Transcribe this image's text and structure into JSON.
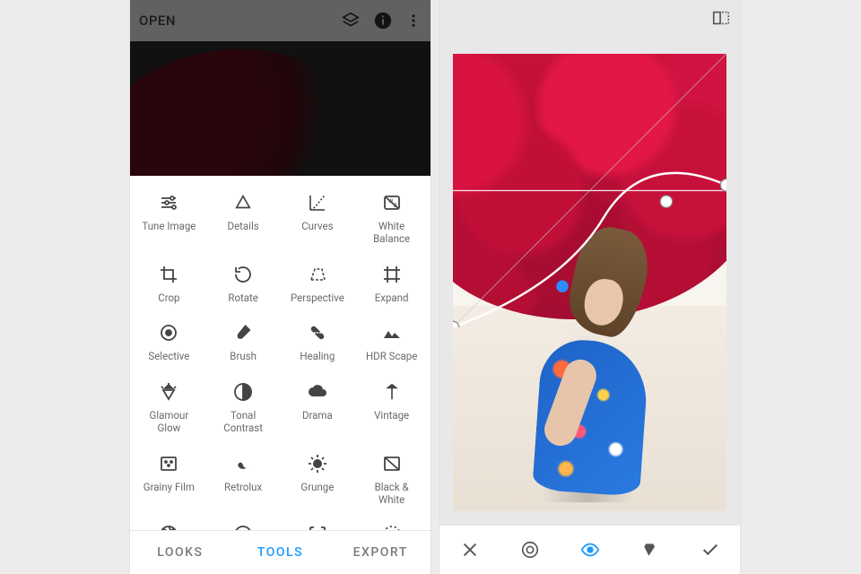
{
  "left": {
    "topbar": {
      "open_label": "OPEN"
    },
    "tools": [
      {
        "id": "tune-image",
        "label": "Tune Image"
      },
      {
        "id": "details",
        "label": "Details"
      },
      {
        "id": "curves",
        "label": "Curves"
      },
      {
        "id": "white-balance",
        "label": "White\nBalance"
      },
      {
        "id": "crop",
        "label": "Crop"
      },
      {
        "id": "rotate",
        "label": "Rotate"
      },
      {
        "id": "perspective",
        "label": "Perspective"
      },
      {
        "id": "expand",
        "label": "Expand"
      },
      {
        "id": "selective",
        "label": "Selective"
      },
      {
        "id": "brush",
        "label": "Brush"
      },
      {
        "id": "healing",
        "label": "Healing"
      },
      {
        "id": "hdr-scape",
        "label": "HDR Scape"
      },
      {
        "id": "glamour-glow",
        "label": "Glamour\nGlow"
      },
      {
        "id": "tonal-contrast",
        "label": "Tonal\nContrast"
      },
      {
        "id": "drama",
        "label": "Drama"
      },
      {
        "id": "vintage",
        "label": "Vintage"
      },
      {
        "id": "grainy-film",
        "label": "Grainy Film"
      },
      {
        "id": "retrolux",
        "label": "Retrolux"
      },
      {
        "id": "grunge",
        "label": "Grunge"
      },
      {
        "id": "black-white",
        "label": "Black &\nWhite"
      },
      {
        "id": "lens-blur",
        "label": ""
      },
      {
        "id": "face",
        "label": ""
      },
      {
        "id": "face-enhance",
        "label": ""
      },
      {
        "id": "noir",
        "label": ""
      }
    ],
    "bottom_tabs": {
      "looks": "LOOKS",
      "tools": "TOOLS",
      "export": "EXPORT",
      "active": "tools"
    }
  },
  "right": {
    "bottom_actions": {
      "close": "close",
      "histogram": "histogram",
      "visibility": "visibility",
      "channel": "channel",
      "confirm": "confirm",
      "active": "visibility"
    }
  }
}
